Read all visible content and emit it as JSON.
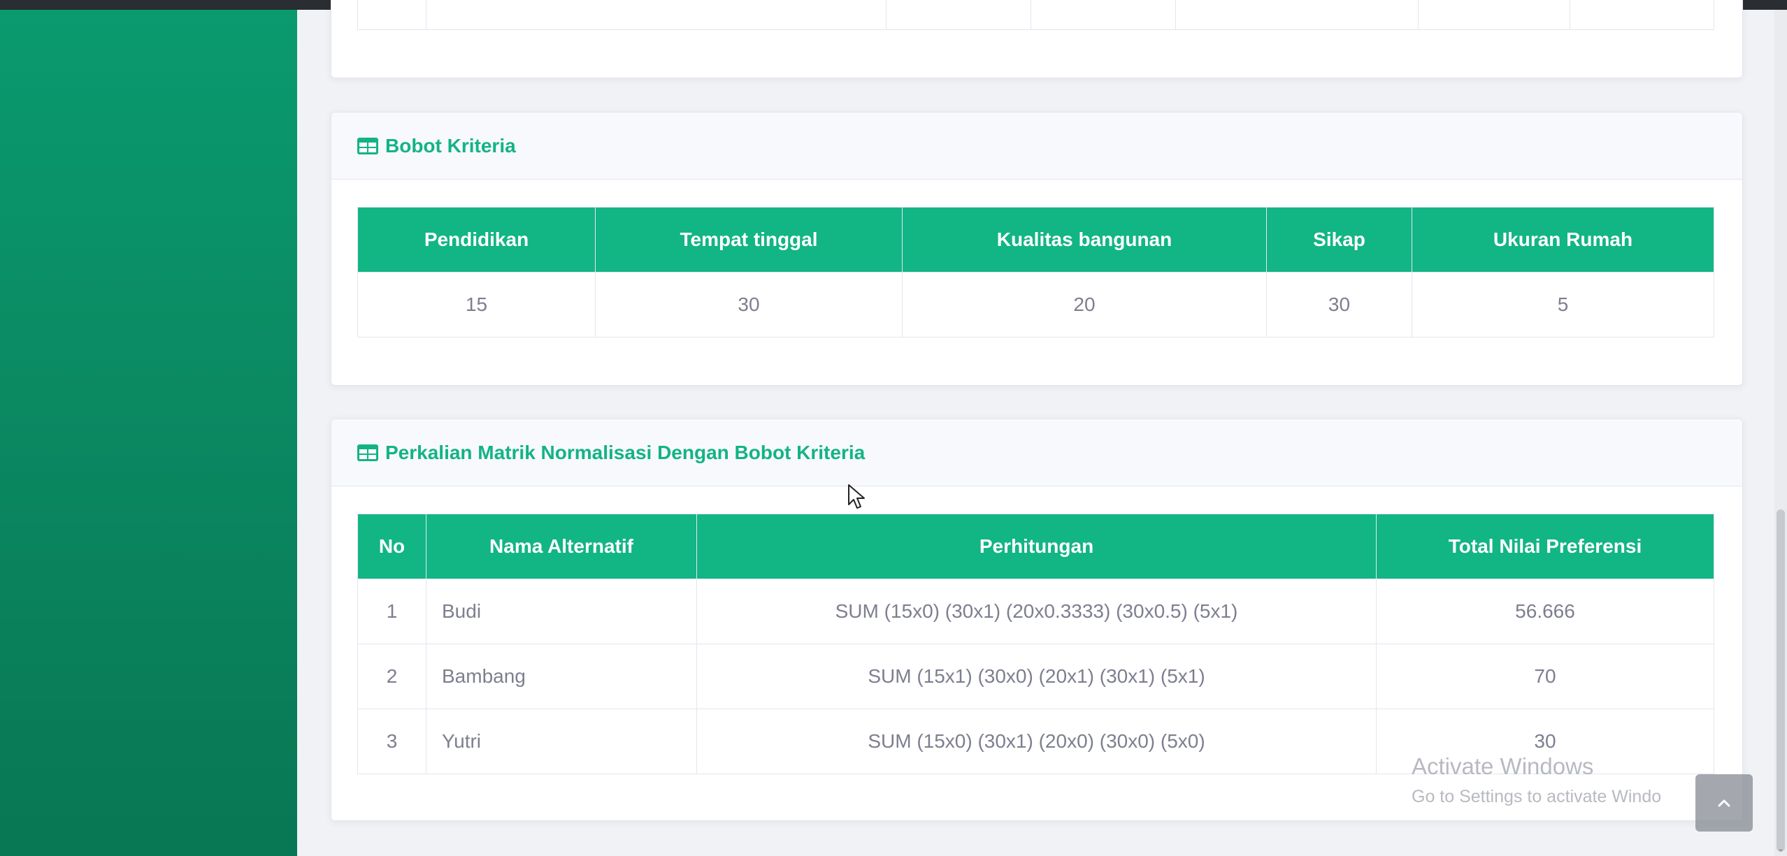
{
  "bobot_section": {
    "title": "Bobot Kriteria",
    "columns": [
      "Pendidikan",
      "Tempat tinggal",
      "Kualitas bangunan",
      "Sikap",
      "Ukuran Rumah"
    ],
    "values": [
      "15",
      "30",
      "20",
      "30",
      "5"
    ]
  },
  "perkalian_section": {
    "title": "Perkalian Matrik Normalisasi Dengan Bobot Kriteria",
    "columns": [
      "No",
      "Nama Alternatif",
      "Perhitungan",
      "Total Nilai Preferensi"
    ],
    "rows": [
      {
        "no": "1",
        "nama": "Budi",
        "perhitungan": "SUM (15x0) (30x1) (20x0.3333) (30x0.5) (5x1)",
        "total": "56.666"
      },
      {
        "no": "2",
        "nama": "Bambang",
        "perhitungan": "SUM (15x1) (30x0) (20x1) (30x1) (5x1)",
        "total": "70"
      },
      {
        "no": "3",
        "nama": "Yutri",
        "perhitungan": "SUM (15x0) (30x1) (20x0) (30x0) (5x0)",
        "total": "30"
      }
    ]
  },
  "watermark": {
    "title": "Activate Windows",
    "subtitle": "Go to Settings to activate Windo"
  },
  "colors": {
    "accent": "#13b386",
    "sidebar": "#0b8a62",
    "table_header": "#12b584"
  },
  "icons": {
    "section_icon": "table-icon",
    "back_to_top": "chevron-up-icon",
    "cursor": "mouse-pointer-icon"
  }
}
